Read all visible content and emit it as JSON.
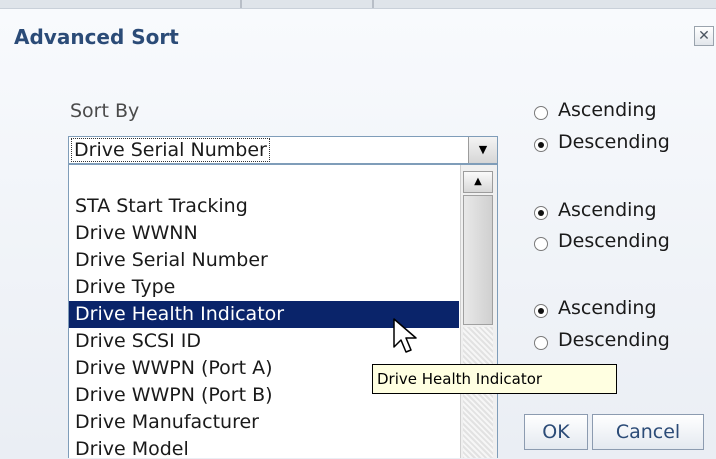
{
  "dialog": {
    "title": "Advanced Sort",
    "close_icon": "close-icon",
    "close_glyph": "✕"
  },
  "sort_by": {
    "label": "Sort By",
    "selected_value": "Drive Serial Number",
    "options": [
      "STA Start Tracking",
      "Drive WWNN",
      "Drive Serial Number",
      "Drive Type",
      "Drive Health Indicator",
      "Drive SCSI ID",
      "Drive WWPN (Port A)",
      "Drive WWPN (Port B)",
      "Drive Manufacturer",
      "Drive Model"
    ],
    "highlighted_option": "Drive Health Indicator"
  },
  "order_groups": [
    {
      "ascending_label": "Ascending",
      "descending_label": "Descending",
      "checked": "Descending"
    },
    {
      "ascending_label": "Ascending",
      "descending_label": "Descending",
      "checked": "Ascending"
    },
    {
      "ascending_label": "Ascending",
      "descending_label": "Descending",
      "checked": "Ascending"
    }
  ],
  "tooltip": "Drive Health Indicator",
  "buttons": {
    "ok_label": "OK",
    "cancel_label": "Cancel"
  },
  "colors": {
    "title": "#2b4b77",
    "selection": "#0a246a",
    "tooltip_bg": "#ffffe1"
  }
}
